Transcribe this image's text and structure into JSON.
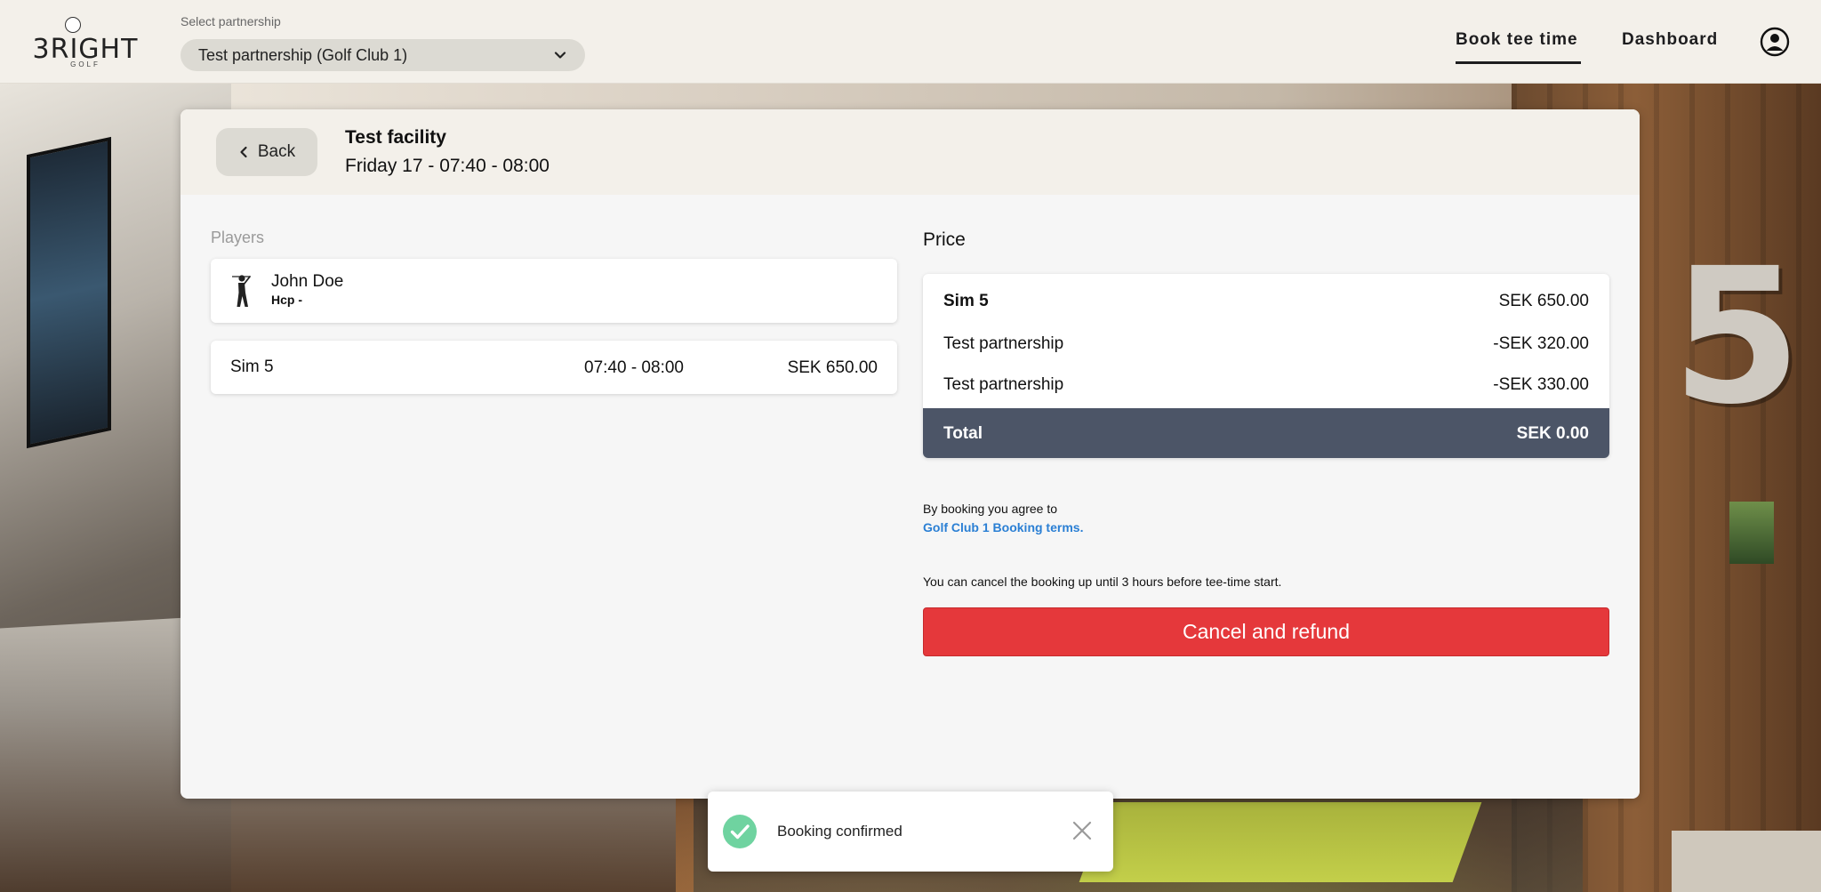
{
  "header": {
    "logo_text": "3RIGHT",
    "logo_sub": "GOLF",
    "select_label": "Select partnership",
    "selected_partnership": "Test partnership (Golf Club 1)",
    "nav": {
      "book_tee_time": "Book tee time",
      "dashboard": "Dashboard"
    }
  },
  "booking": {
    "back_label": "Back",
    "facility": "Test facility",
    "date_time": "Friday 17 - 07:40 - 08:00",
    "players_label": "Players",
    "player": {
      "name": "John Doe",
      "hcp": "Hcp -"
    },
    "sim_row": {
      "sim": "Sim 5",
      "time": "07:40 - 08:00",
      "price": "SEK 650.00"
    }
  },
  "price": {
    "label": "Price",
    "rows": [
      {
        "label": "Sim 5",
        "amount": "SEK 650.00"
      },
      {
        "label": "Test partnership",
        "amount": "-SEK 320.00"
      },
      {
        "label": "Test partnership",
        "amount": "-SEK 330.00"
      }
    ],
    "total_label": "Total",
    "total_amount": "SEK 0.00"
  },
  "terms": {
    "text": "By booking you agree to",
    "link": "Golf Club 1 Booking terms.",
    "cancel_info": "You can cancel the booking up until 3 hours before tee-time start.",
    "cancel_button": "Cancel and refund"
  },
  "toast": {
    "message": "Booking confirmed"
  },
  "colors": {
    "header_bg": "#f3f0ea",
    "total_bg": "#4c5567",
    "cancel_red": "#e5383b",
    "link_blue": "#2a7fd4",
    "success_green": "#6fd3a0"
  }
}
